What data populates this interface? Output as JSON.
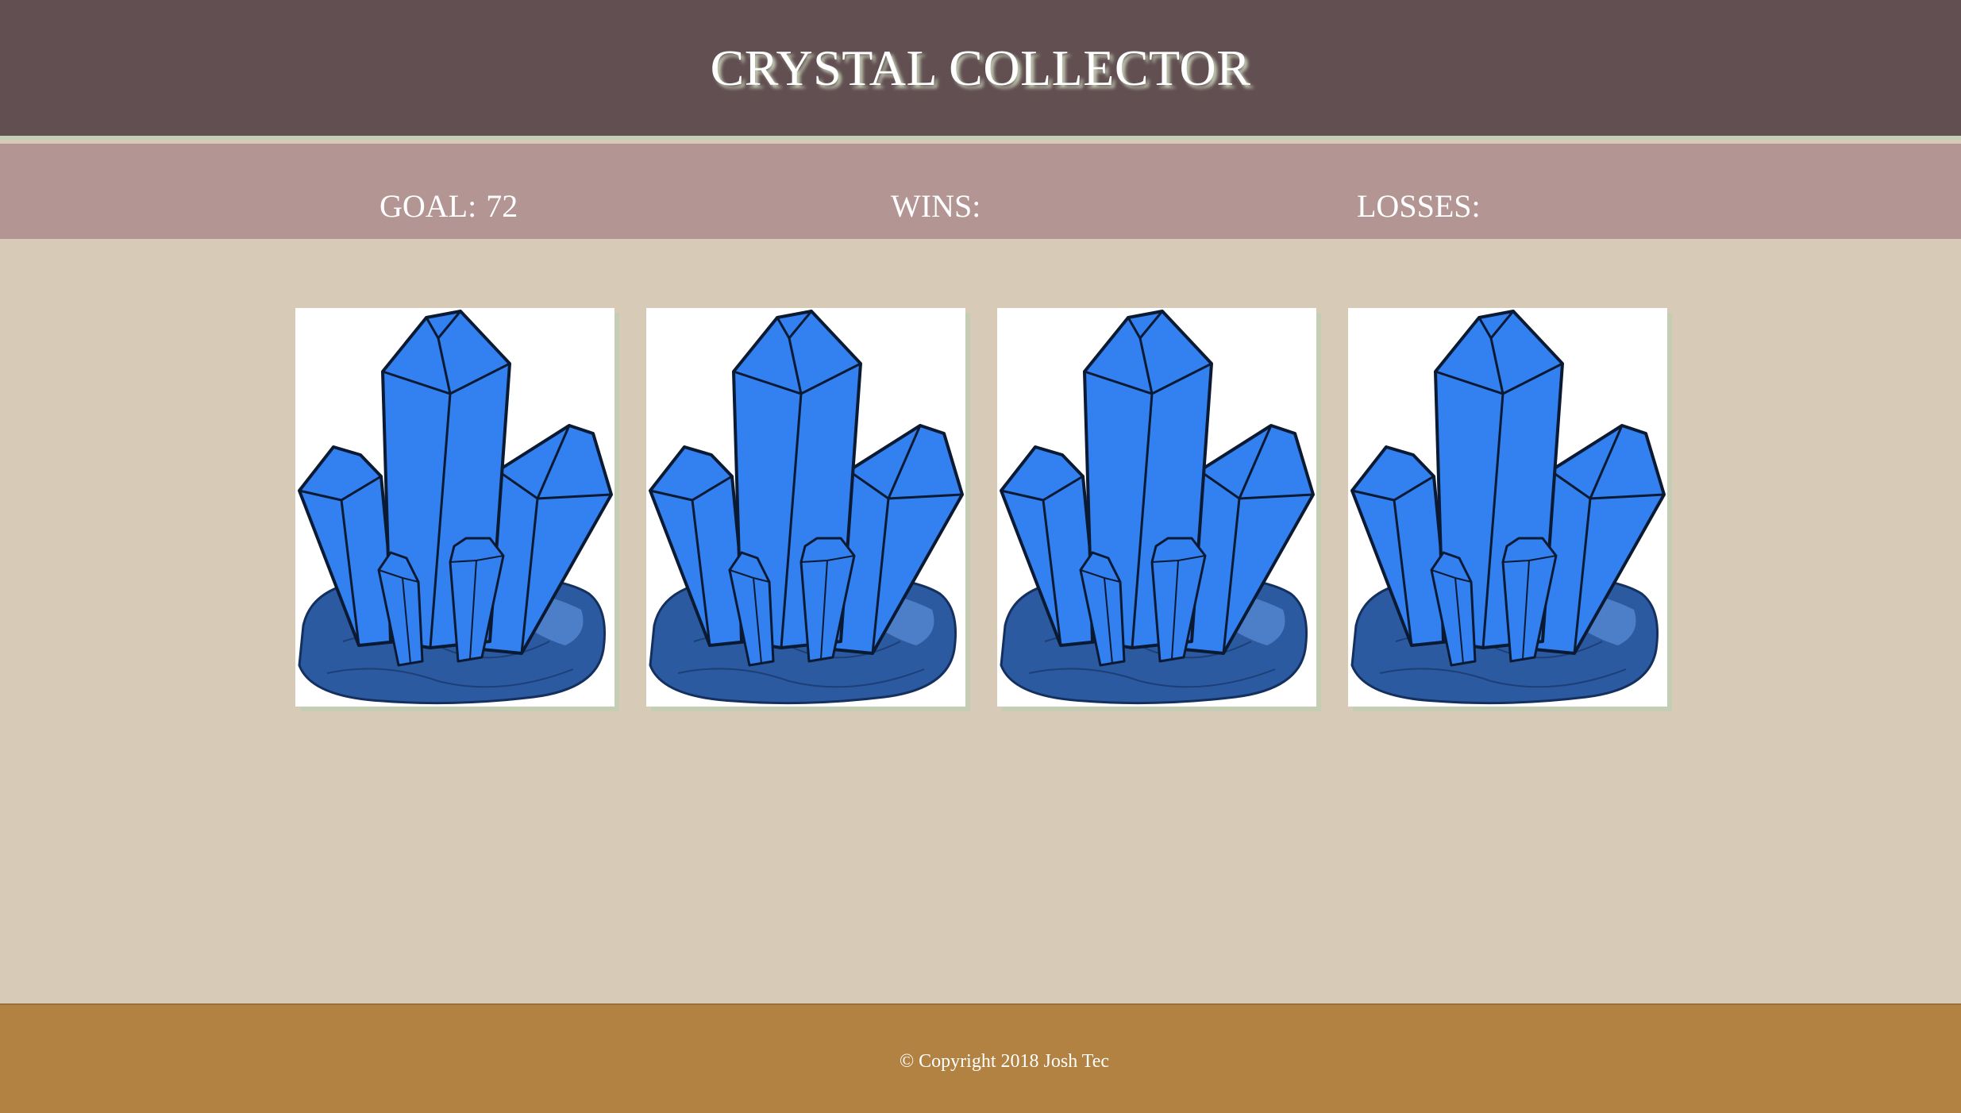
{
  "header": {
    "title": "CRYSTAL COLLECTOR"
  },
  "scoreboard": {
    "goal_label": "GOAL:",
    "goal_value": "72",
    "wins_label": "WINS:",
    "wins_value": "",
    "losses_label": "LOSSES:",
    "losses_value": ""
  },
  "crystals": [
    {
      "name": "crystal-1",
      "icon": "blue-crystal-cluster-icon"
    },
    {
      "name": "crystal-2",
      "icon": "blue-crystal-cluster-icon"
    },
    {
      "name": "crystal-3",
      "icon": "blue-crystal-cluster-icon"
    },
    {
      "name": "crystal-4",
      "icon": "blue-crystal-cluster-icon"
    }
  ],
  "footer": {
    "copyright": "© Copyright 2018 Josh Tec"
  },
  "colors": {
    "header_bg": "#614f51",
    "status_bg": "#b39594",
    "body_bg": "#d7cbb8",
    "footer_bg": "#b18242",
    "crystal_fill": "#3380f0",
    "rock_fill": "#2c5aa0"
  }
}
